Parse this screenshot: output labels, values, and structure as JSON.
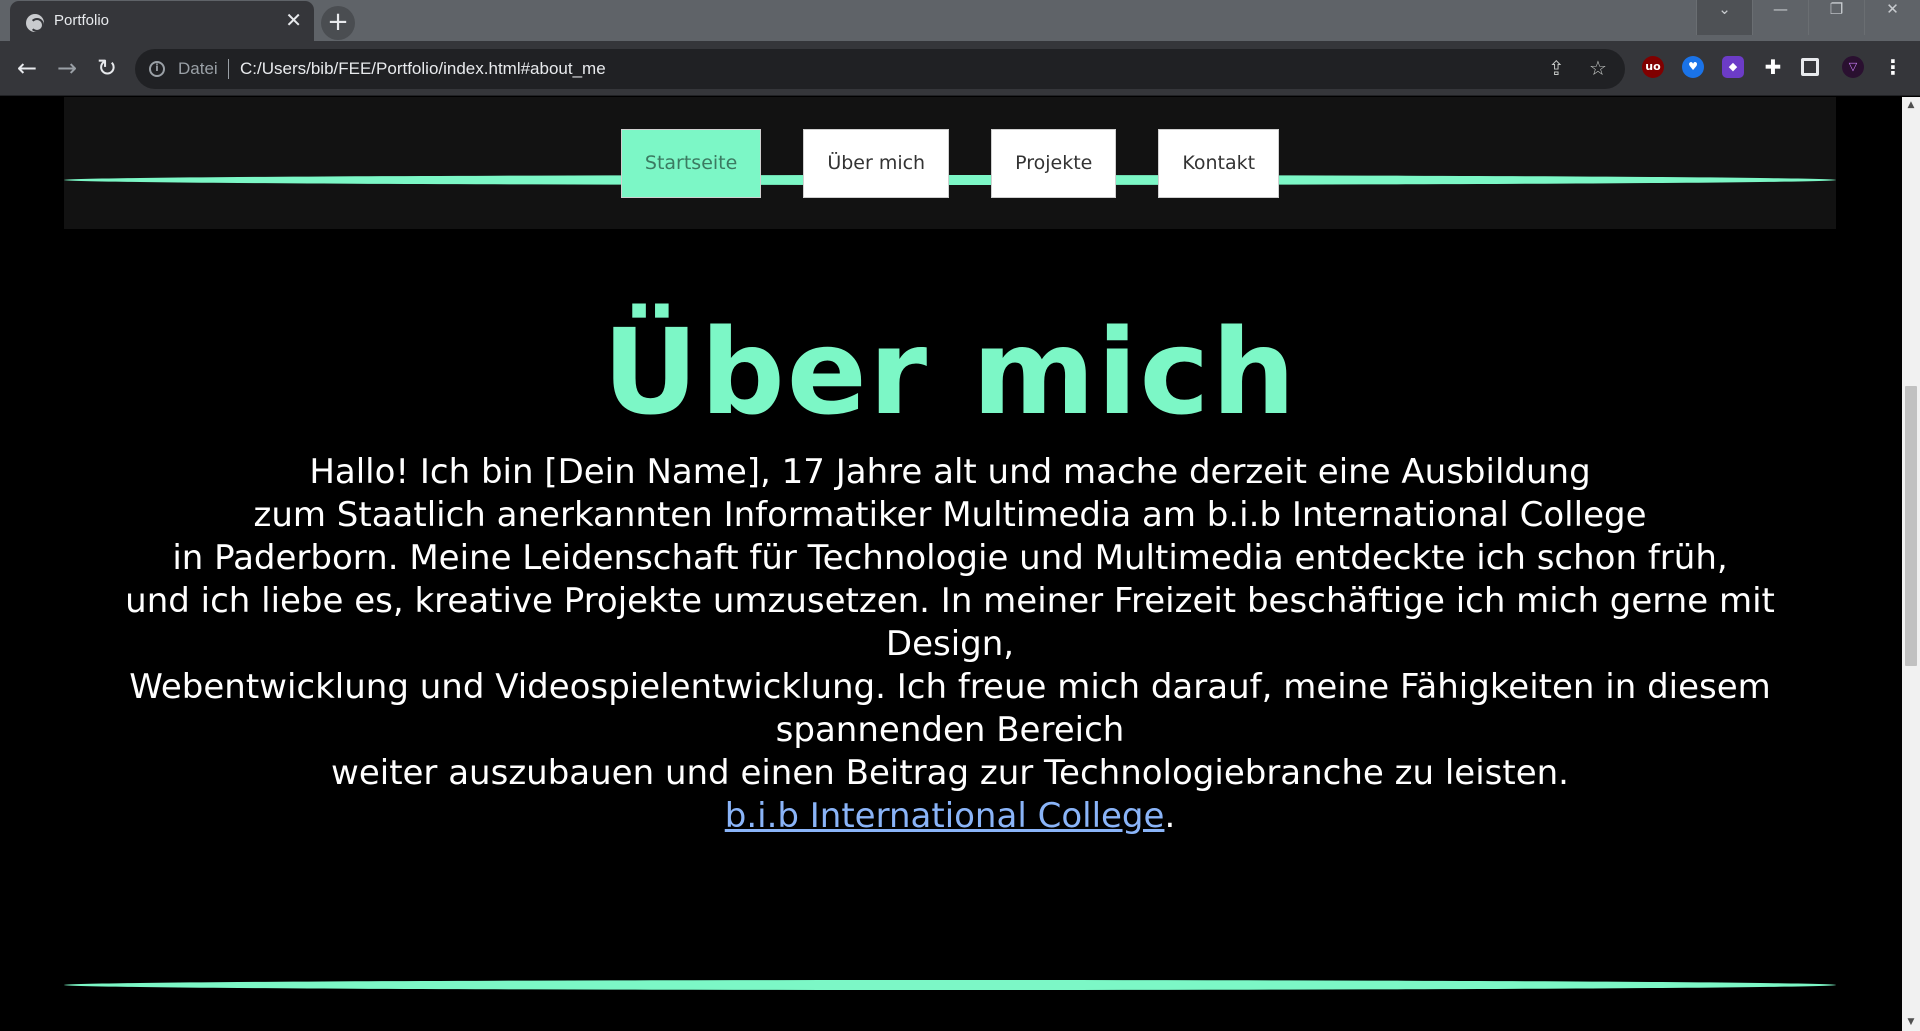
{
  "browser": {
    "tab_title": "Portfolio",
    "tab_close": "✕",
    "new_tab": "+",
    "url_scheme": "Datei",
    "url": "C:/Users/bib/FEE/Portfolio/index.html#about_me",
    "window_controls": {
      "dropdown": "⌄",
      "minimize": "—",
      "restore": "❐",
      "close": "✕"
    }
  },
  "nav": {
    "items": [
      {
        "label": "Startseite",
        "active": true
      },
      {
        "label": "Über mich",
        "active": false
      },
      {
        "label": "Projekte",
        "active": false
      },
      {
        "label": "Kontakt",
        "active": false
      }
    ]
  },
  "about": {
    "title": "Über mich",
    "lines": [
      "Hallo! Ich bin [Dein Name], 17 Jahre alt und mache derzeit eine Ausbildung",
      "zum Staatlich anerkannten Informatiker Multimedia am b.i.b International College",
      "in Paderborn. Meine Leidenschaft für Technologie und Multimedia entdeckte ich schon früh,",
      "und ich liebe es, kreative Projekte umzusetzen. In meiner Freizeit beschäftige ich mich gerne mit Design,",
      "Webentwicklung und Videospielentwicklung. Ich freue mich darauf, meine Fähigkeiten in diesem spannenden Bereich",
      "weiter auszubauen und einen Beitrag zur Technologiebranche zu leisten."
    ],
    "link_text": "b.i.b International College",
    "link_suffix": "."
  },
  "colors": {
    "accent": "#7cf7c6",
    "header_bg": "#121212",
    "page_bg": "#000000"
  }
}
